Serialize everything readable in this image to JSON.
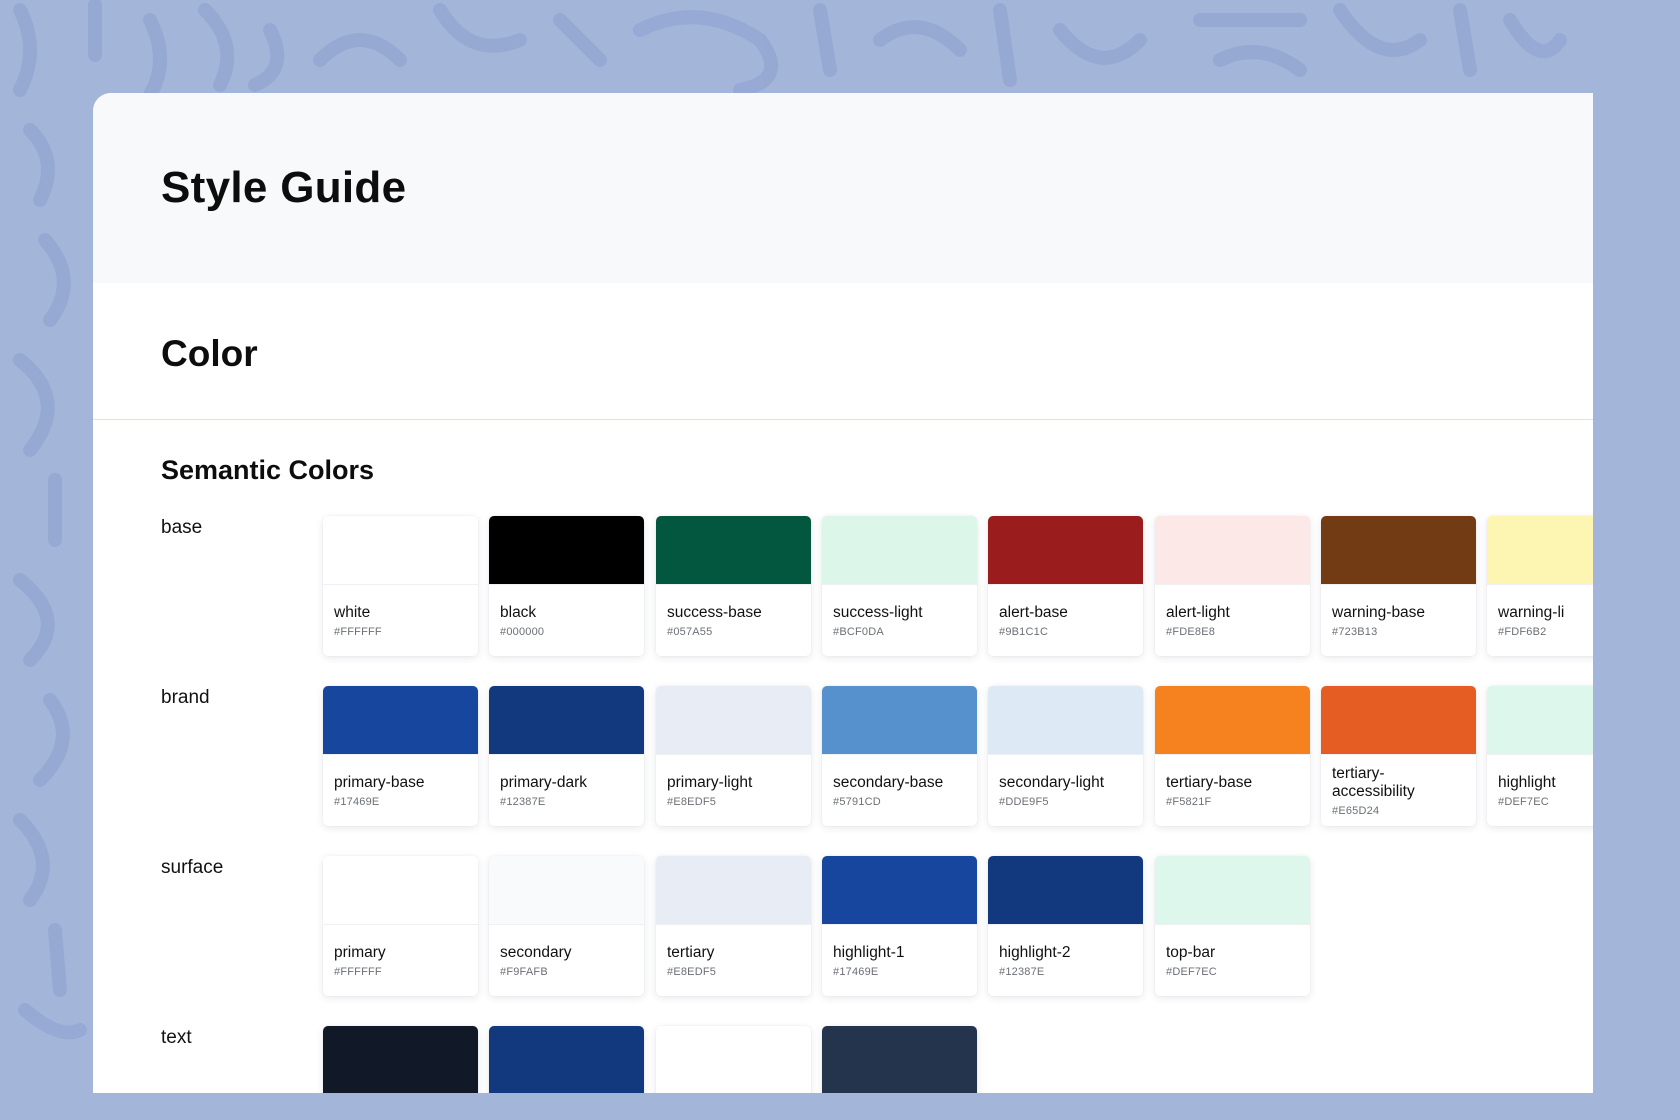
{
  "page": {
    "title": "Style Guide"
  },
  "section": {
    "title": "Color"
  },
  "subsection": {
    "title": "Semantic Colors"
  },
  "groups": [
    {
      "label": "base",
      "swatches": [
        {
          "name": "white",
          "hex": "#FFFFFF",
          "color": "#FFFFFF"
        },
        {
          "name": "black",
          "hex": "#000000",
          "color": "#000000"
        },
        {
          "name": "success-base",
          "hex": "#057A55",
          "color": "#03573F"
        },
        {
          "name": "success-light",
          "hex": "#BCF0DA",
          "color": "#DCF6EA"
        },
        {
          "name": "alert-base",
          "hex": "#9B1C1C",
          "color": "#9B1C1C"
        },
        {
          "name": "alert-light",
          "hex": "#FDE8E8",
          "color": "#FDE8E8"
        },
        {
          "name": "warning-base",
          "hex": "#723B13",
          "color": "#723B13"
        },
        {
          "name": "warning-li",
          "hex": "#FDF6B2",
          "color": "#FDF6B2"
        }
      ]
    },
    {
      "label": "brand",
      "swatches": [
        {
          "name": "primary-base",
          "hex": "#17469E",
          "color": "#17469E"
        },
        {
          "name": "primary-dark",
          "hex": "#12387E",
          "color": "#12387E"
        },
        {
          "name": "primary-light",
          "hex": "#E8EDF5",
          "color": "#E8EDF5"
        },
        {
          "name": "secondary-base",
          "hex": "#5791CD",
          "color": "#5791CD"
        },
        {
          "name": "secondary-light",
          "hex": "#DDE9F5",
          "color": "#DDE9F5"
        },
        {
          "name": "tertiary-base",
          "hex": "#F5821F",
          "color": "#F5821F"
        },
        {
          "name": "tertiary-accessibility",
          "hex": "#E65D24",
          "color": "#E65D24"
        },
        {
          "name": "highlight",
          "hex": "#DEF7EC",
          "color": "#DEF7EC"
        }
      ]
    },
    {
      "label": "surface",
      "swatches": [
        {
          "name": "primary",
          "hex": "#FFFFFF",
          "color": "#FFFFFF"
        },
        {
          "name": "secondary",
          "hex": "#F9FAFB",
          "color": "#F9FAFB"
        },
        {
          "name": "tertiary",
          "hex": "#E8EDF5",
          "color": "#E8EDF5"
        },
        {
          "name": "highlight-1",
          "hex": "#17469E",
          "color": "#17469E"
        },
        {
          "name": "highlight-2",
          "hex": "#12387E",
          "color": "#12387E"
        },
        {
          "name": "top-bar",
          "hex": "#DEF7EC",
          "color": "#DEF7EC"
        }
      ]
    },
    {
      "label": "text",
      "swatches": [
        {
          "name": "",
          "hex": "",
          "color": "#111827"
        },
        {
          "name": "",
          "hex": "",
          "color": "#12387E"
        },
        {
          "name": "",
          "hex": "",
          "color": "#FFFFFF"
        },
        {
          "name": "",
          "hex": "",
          "color": "#24344D"
        }
      ]
    }
  ],
  "colors": {
    "background": "#A3B5D9",
    "pattern": "#93A8D2",
    "header_bg": "#F8F9FB"
  }
}
